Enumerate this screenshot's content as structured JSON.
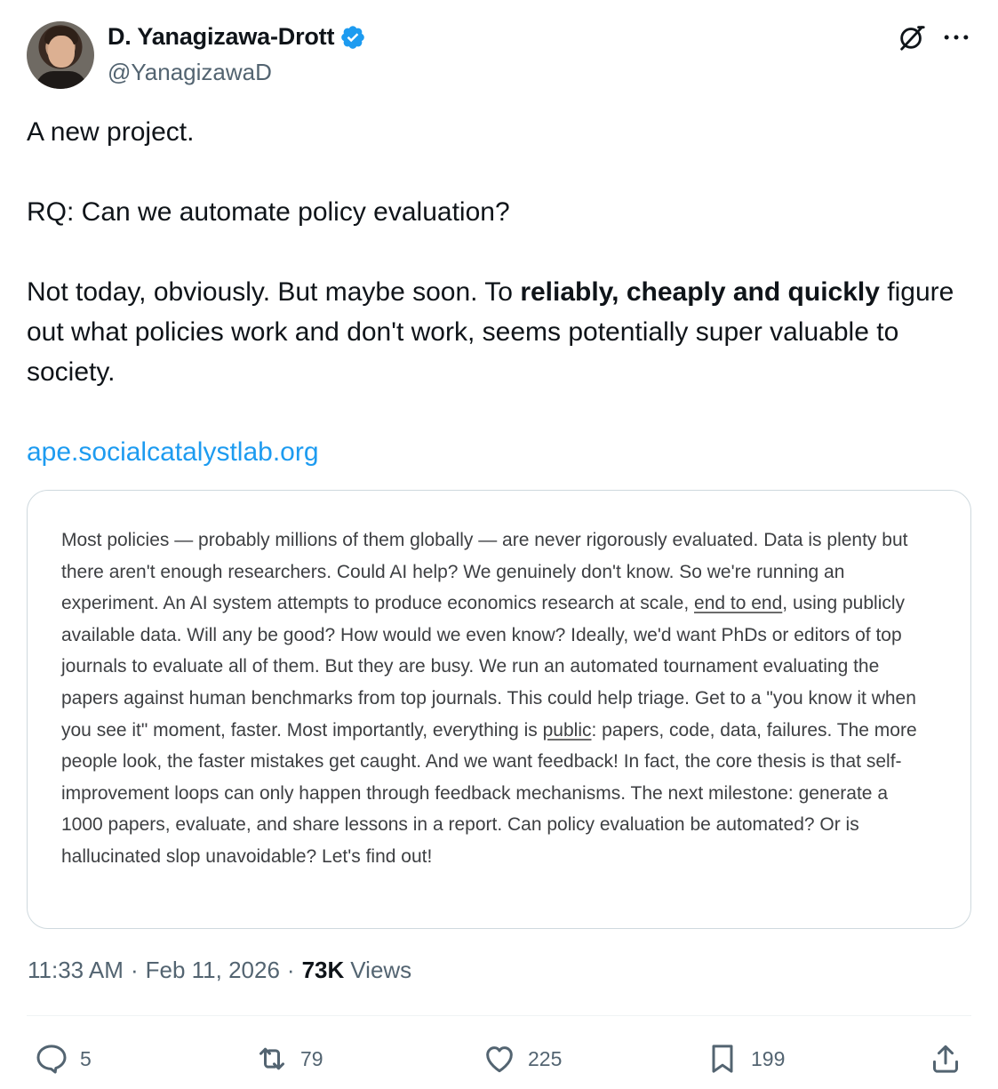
{
  "author": {
    "display_name": "D. Yanagizawa-Drott",
    "handle": "@YanagizawaD",
    "verified": true,
    "avatar_icon": "profile-photo"
  },
  "top_actions": {
    "grok_icon": "grok-icon",
    "more_icon": "more-icon"
  },
  "tweet": {
    "line1": "A new project.",
    "line2": "RQ: Can we automate policy evaluation?",
    "line3_pre": "Not today, obviously. But maybe soon. To ",
    "line3_bold": "reliably, cheaply and quickly",
    "line3_post": " figure out what policies work and don't work, seems potentially super valuable to society.",
    "link": "ape.socialcatalystlab.org"
  },
  "card": {
    "t1": "Most policies — probably millions of them globally — are never rigorously evaluated. Data is plenty but there aren't enough researchers. Could AI help? We genuinely don't know. So we're running an experiment. An AI system attempts to produce economics research at scale, ",
    "t1_link": "end to end",
    "t2": ", using publicly available data. Will any be good? How would we even know? Ideally, we'd want PhDs or editors of top journals to evaluate all of them. But they are busy. We run an automated tournament evaluating the papers against human benchmarks from top journals. This could help triage. Get to a \"you know it when you see it\" moment, faster. Most importantly, everything is ",
    "t2_link": "public",
    "t3": ": papers, code, data, failures. The more people look, the faster mistakes get caught. And we want feedback! In fact, the core thesis is that self-improvement loops can only happen through feedback mechanisms. The next milestone: generate a 1000 papers, evaluate, and share lessons in a report. Can policy evaluation be automated? Or is hallucinated slop unavoidable? Let's find out!"
  },
  "meta": {
    "time": "11:33 AM",
    "date": "Feb 11, 2026",
    "views_count": "73K",
    "views_label": "Views",
    "sep": "·"
  },
  "actions": {
    "replies": "5",
    "reposts": "79",
    "likes": "225",
    "bookmarks": "199"
  },
  "colors": {
    "link": "#1d9bf0",
    "verified": "#1d9bf0",
    "secondary_text": "#536471",
    "primary_text": "#0f1419"
  }
}
